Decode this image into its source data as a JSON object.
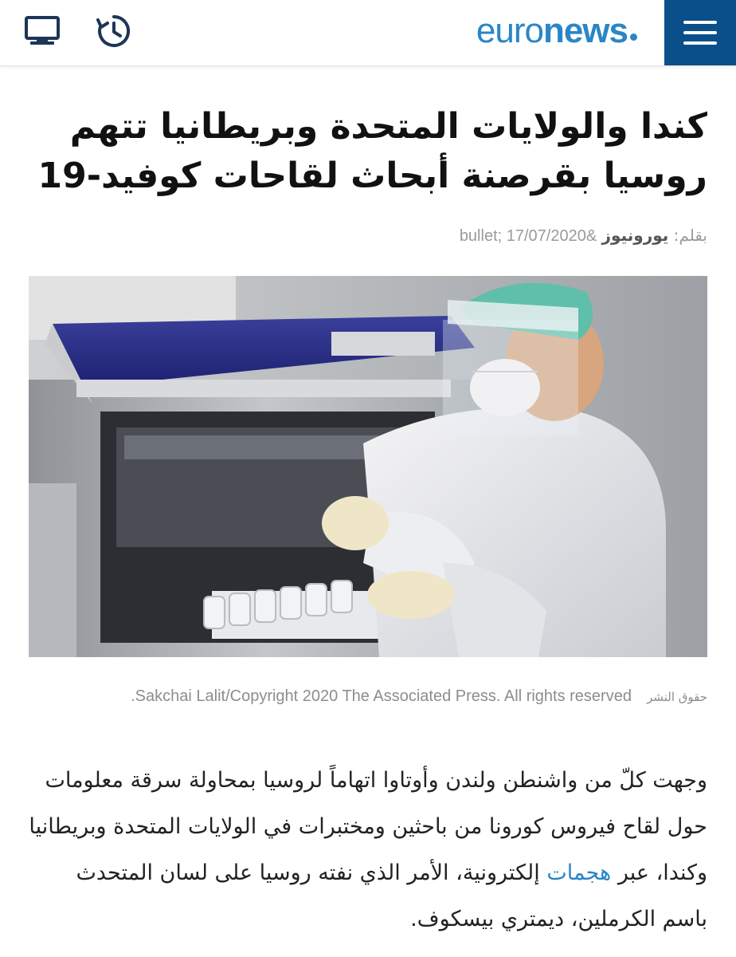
{
  "header": {
    "logo_part1": "euro",
    "logo_part2": "news",
    "brand_color": "#2a86c6",
    "menu_bg_color": "#0a4f8a",
    "icons": [
      "tv-icon",
      "history-clock-icon",
      "hamburger-menu-icon"
    ]
  },
  "article": {
    "title": "كندا والولايات المتحدة وبريطانيا تتهم روسيا بقرصنة أبحاث لقاحات كوفيد-19",
    "byline_prefix": "بقلم:",
    "author": "يورونيوز",
    "date": "&bullet;  17/07/2020",
    "image_rights_label": "حقوق النشر",
    "image_credit": "Sakchai Lalit/Copyright 2020 The Associated Press. All rights reserved.",
    "body_before_link": "وجهت كلّ من واشنطن ولندن وأوتاوا اتهاماً لروسيا بمحاولة سرقة معلومات حول لقاح فيروس كورونا من باحثين ومختبرات في الولايات المتحدة وبريطانيا وكندا، عبر",
    "body_link": "هجمات",
    "body_after_link": "إلكترونية، الأمر الذي نفته روسيا على لسان المتحدث باسم الكرملين، ديمتري بيسكوف.",
    "link_color": "#2a86c6"
  }
}
